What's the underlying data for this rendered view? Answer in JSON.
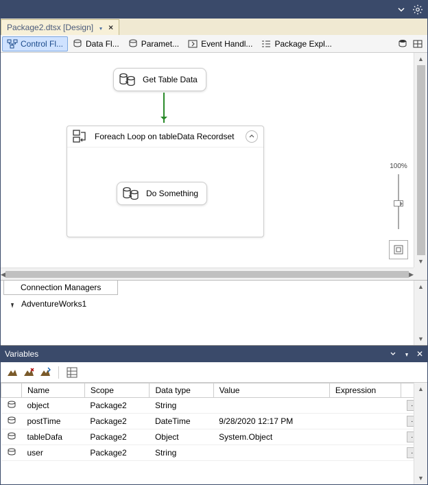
{
  "titlebar": {},
  "tab": {
    "label": "Package2.dtsx [Design]"
  },
  "nav": {
    "control_flow": "Control Fl...",
    "data_flow": "Data Fl...",
    "parameters": "Paramet...",
    "event_handlers": "Event Handl...",
    "package_explorer": "Package Expl..."
  },
  "canvas": {
    "task_get_table": "Get Table Data",
    "loop_label": "Foreach Loop on tableData Recordset",
    "task_do_something": "Do Something"
  },
  "zoom": {
    "label": "100%"
  },
  "connection_managers": {
    "title": "Connection Managers",
    "items": [
      {
        "name": "AdventureWorks1"
      }
    ]
  },
  "variables": {
    "title": "Variables",
    "columns": {
      "name": "Name",
      "scope": "Scope",
      "data_type": "Data type",
      "value": "Value",
      "expression": "Expression"
    },
    "rows": [
      {
        "name": "object",
        "scope": "Package2",
        "data_type": "String",
        "value": "",
        "expression": ""
      },
      {
        "name": "postTime",
        "scope": "Package2",
        "data_type": "DateTime",
        "value": "9/28/2020 12:17 PM",
        "expression": ""
      },
      {
        "name": "tableDafa",
        "scope": "Package2",
        "data_type": "Object",
        "value": "System.Object",
        "expression": ""
      },
      {
        "name": "user",
        "scope": "Package2",
        "data_type": "String",
        "value": "",
        "expression": ""
      }
    ]
  }
}
